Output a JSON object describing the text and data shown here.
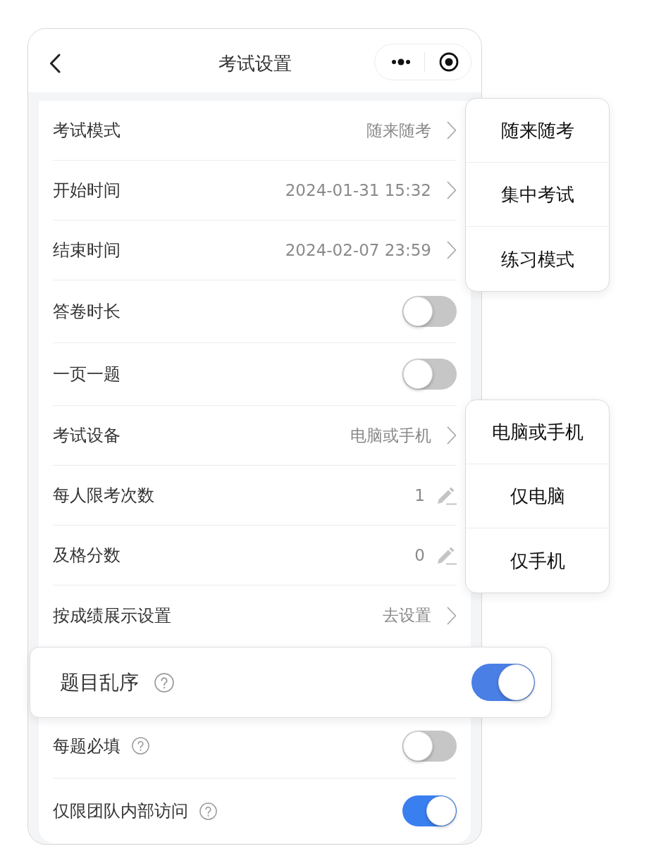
{
  "header": {
    "title": "考试设置"
  },
  "settings": [
    {
      "kind": "select",
      "label": "考试模式",
      "value": "随来随考"
    },
    {
      "kind": "select",
      "label": "开始时间",
      "value": "2024-01-31 15:32"
    },
    {
      "kind": "select",
      "label": "结束时间",
      "value": "2024-02-07 23:59"
    },
    {
      "kind": "toggle",
      "label": "答卷时长",
      "on": false
    },
    {
      "kind": "toggle",
      "label": "一页一题",
      "on": false
    },
    {
      "kind": "select",
      "label": "考试设备",
      "value": "电脑或手机"
    },
    {
      "kind": "edit",
      "label": "每人限考次数",
      "value": "1"
    },
    {
      "kind": "edit",
      "label": "及格分数",
      "value": "0"
    },
    {
      "kind": "select",
      "label": "按成绩展示设置",
      "value": "去设置"
    },
    {
      "kind": "toggle",
      "label": "题目乱序",
      "on": true,
      "help": true,
      "highlighted": true
    },
    {
      "kind": "toggle",
      "label": "每题必填",
      "on": false,
      "help": true
    },
    {
      "kind": "toggle",
      "label": "仅限团队内部访问",
      "on": true,
      "help": true
    }
  ],
  "dropdowns": [
    {
      "options": [
        "随来随考",
        "集中考试",
        "练习模式"
      ]
    },
    {
      "options": [
        "电脑或手机",
        "仅电脑",
        "仅手机"
      ]
    }
  ]
}
